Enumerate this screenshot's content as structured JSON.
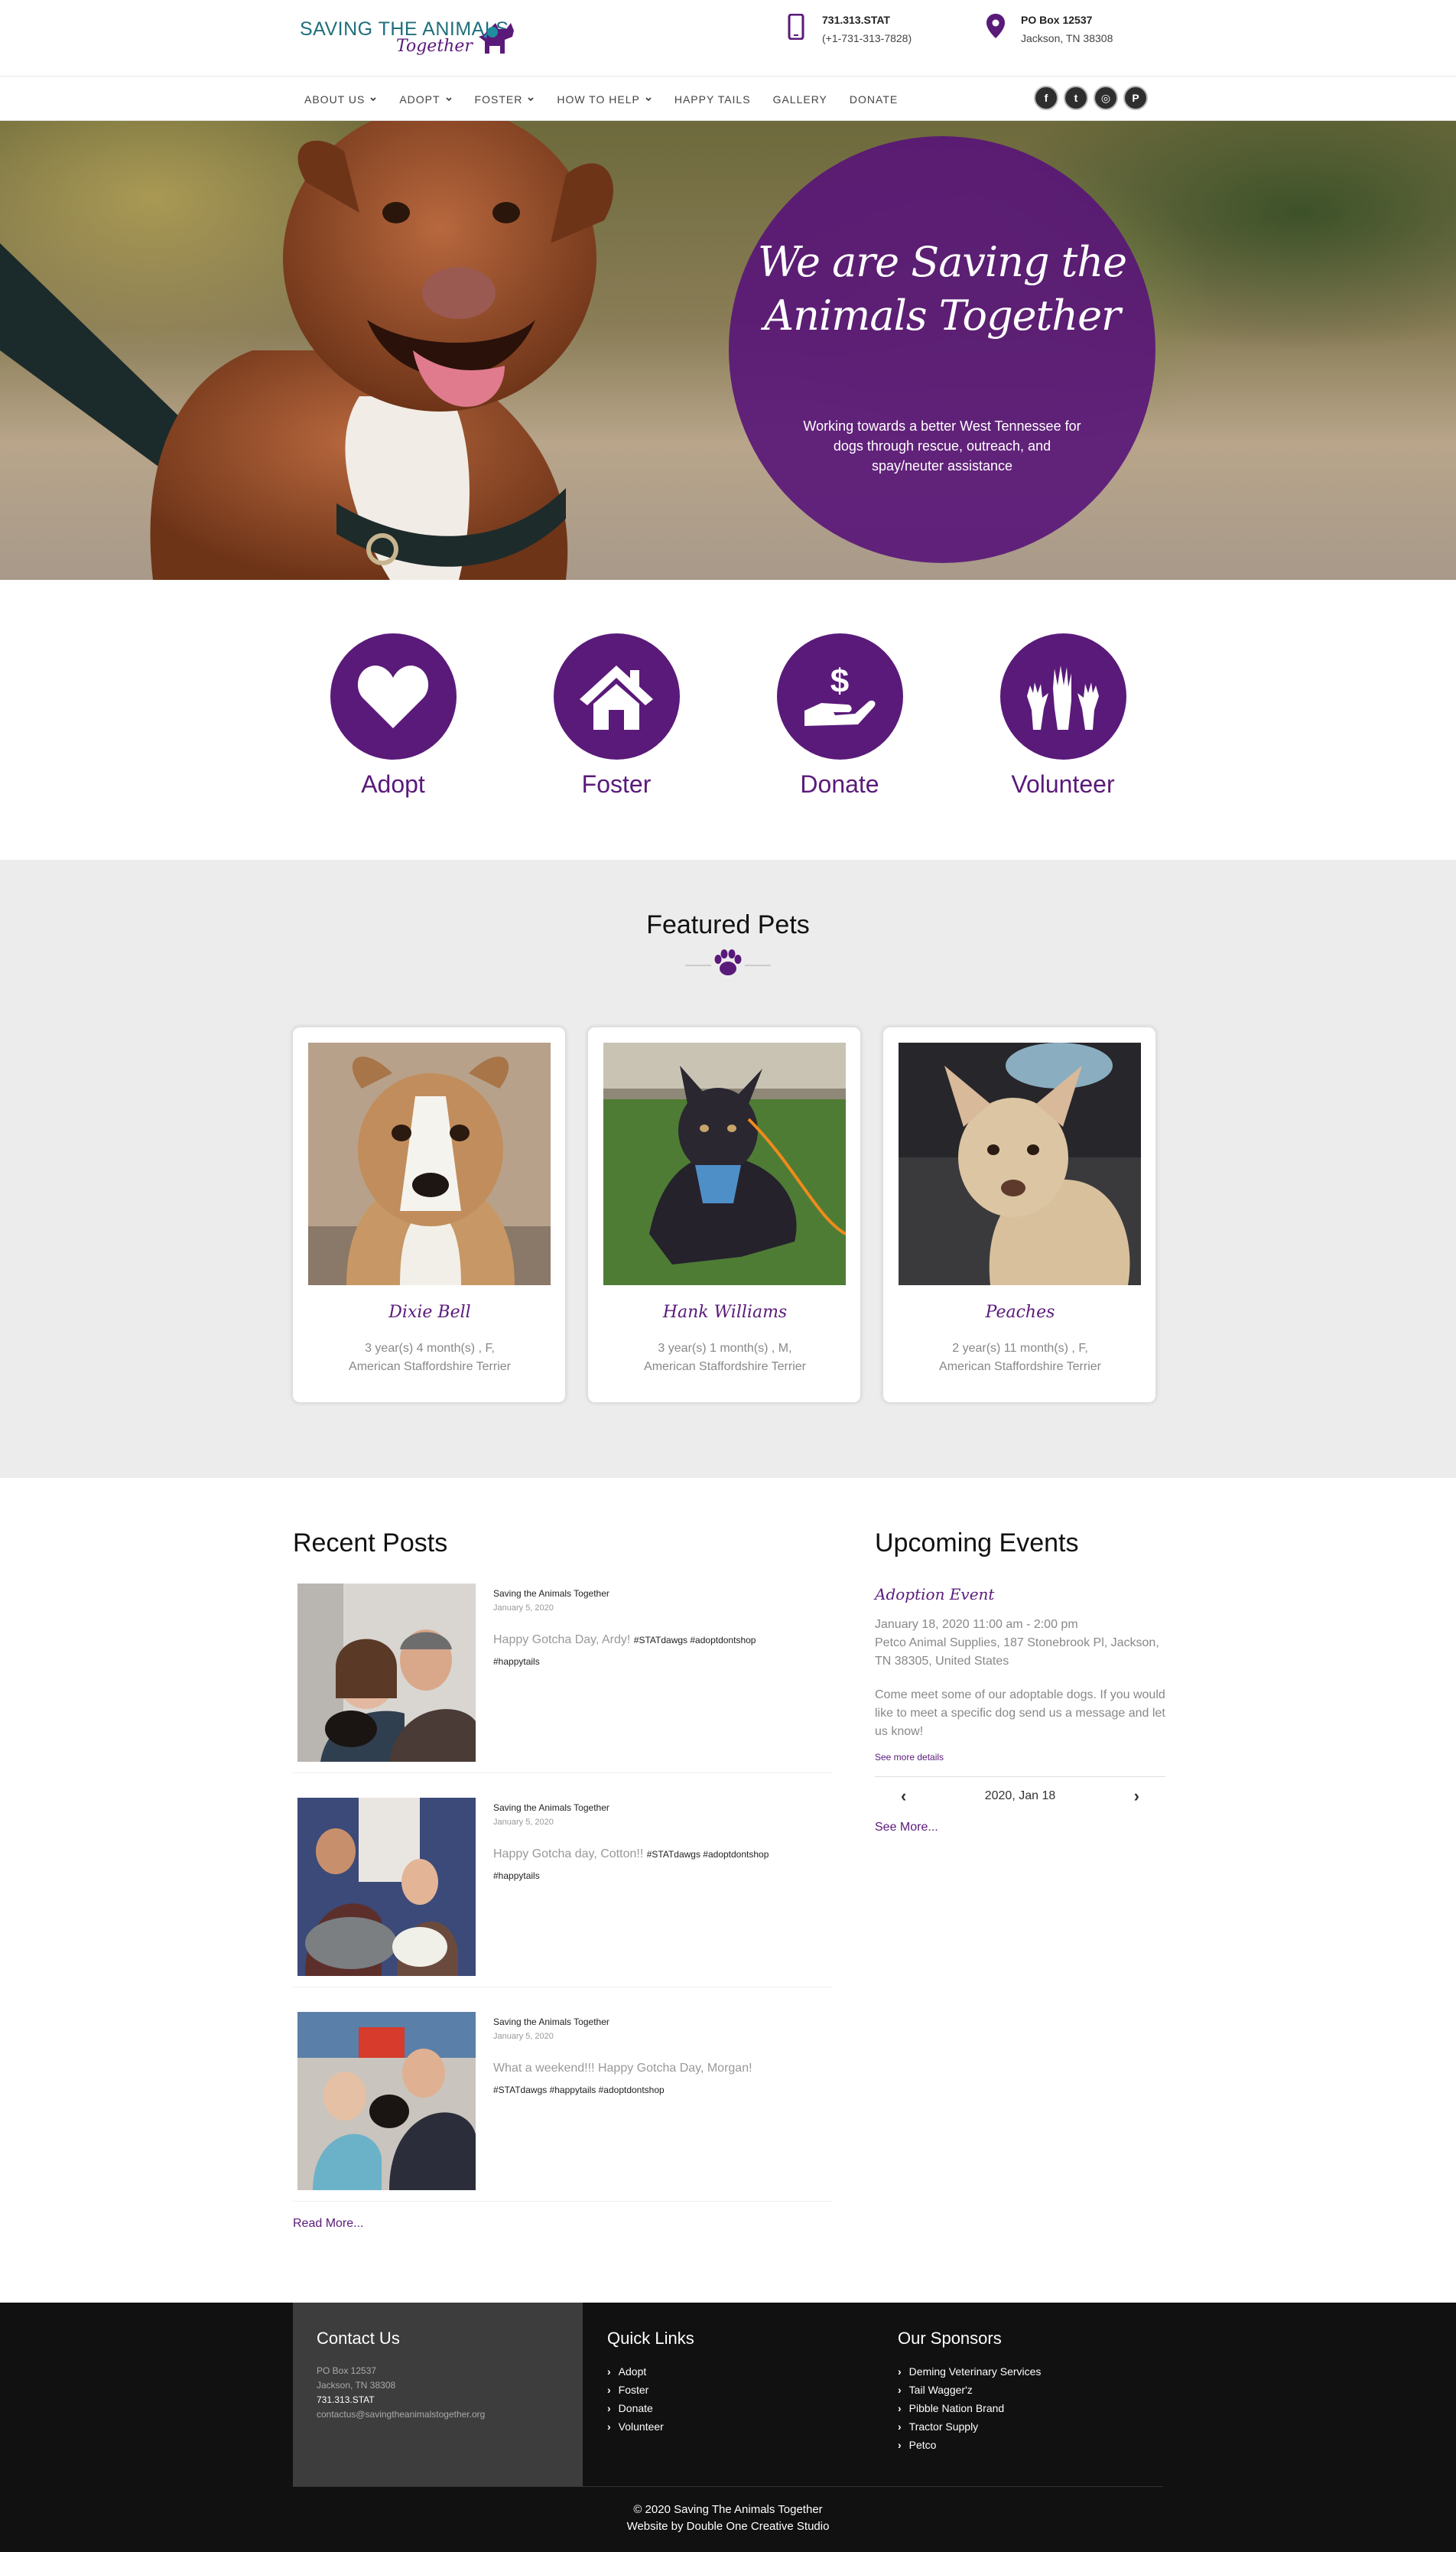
{
  "header": {
    "logo_line1": "SAVING THE ANIMALS",
    "logo_line2": "Together",
    "phone_label": "731.313.STAT",
    "phone_number": "(+1-731-313-7828)",
    "address_line1": "PO Box 12537",
    "address_line2": "Jackson, TN 38308"
  },
  "nav": {
    "items": [
      {
        "label": "ABOUT US",
        "dropdown": true
      },
      {
        "label": "ADOPT",
        "dropdown": true
      },
      {
        "label": "FOSTER",
        "dropdown": true
      },
      {
        "label": "HOW TO HELP",
        "dropdown": true
      },
      {
        "label": "HAPPY TAILS",
        "dropdown": false
      },
      {
        "label": "GALLERY",
        "dropdown": false
      },
      {
        "label": "DONATE",
        "dropdown": false
      }
    ],
    "social": [
      {
        "icon": "facebook-icon",
        "glyph": "f"
      },
      {
        "icon": "twitter-icon",
        "glyph": "t"
      },
      {
        "icon": "instagram-icon",
        "glyph": "◎"
      },
      {
        "icon": "pinterest-icon",
        "glyph": "P"
      }
    ]
  },
  "hero": {
    "title": "We are Saving the Animals Together",
    "subtitle": "Working towards a better West Tennessee for dogs through rescue, outreach, and spay/neuter assistance"
  },
  "actions": [
    {
      "label": "Adopt",
      "icon": "heart-icon"
    },
    {
      "label": "Foster",
      "icon": "house-icon"
    },
    {
      "label": "Donate",
      "icon": "donate-hand-icon"
    },
    {
      "label": "Volunteer",
      "icon": "raised-hands-icon"
    }
  ],
  "featured": {
    "title": "Featured Pets",
    "pets": [
      {
        "name": "Dixie Bell",
        "age": "3 year(s) 4 month(s) , F,",
        "breed": "American Staffordshire Terrier"
      },
      {
        "name": "Hank Williams",
        "age": "3 year(s) 1 month(s) , M,",
        "breed": "American Staffordshire Terrier"
      },
      {
        "name": "Peaches",
        "age": "2 year(s) 11 month(s) , F,",
        "breed": "American Staffordshire Terrier"
      }
    ]
  },
  "posts": {
    "title": "Recent Posts",
    "items": [
      {
        "author": "Saving the Animals Together",
        "date": "January 5, 2020",
        "text": "Happy Gotcha Day, Ardy!",
        "tags_inline": "#STATdawgs #adoptdontshop",
        "tags_next": "#happytails"
      },
      {
        "author": "Saving the Animals Together",
        "date": "January 5, 2020",
        "text": "Happy Gotcha day, Cotton!!",
        "tags_inline": "#STATdawgs #adoptdontshop",
        "tags_next": "#happytails"
      },
      {
        "author": "Saving the Animals Together",
        "date": "January 5, 2020",
        "text": "What a weekend!!! Happy Gotcha Day, Morgan!",
        "tags_inline": "",
        "tags_next": "#STATdawgs #happytails #adoptdontshop"
      }
    ],
    "read_more": "Read More..."
  },
  "events": {
    "title": "Upcoming Events",
    "event_title": "Adoption Event",
    "when": "January 18, 2020  11:00 am - 2:00 pm",
    "where": "Petco Animal Supplies, 187 Stonebrook Pl, Jackson, TN 38305, United States",
    "description": "Come meet some of our adoptable dogs. If you would like to meet a specific dog send us a message and let us know!",
    "see_details": "See more details",
    "cal_label": "2020, Jan 18",
    "see_more": "See More..."
  },
  "footer": {
    "contact_title": "Contact Us",
    "contact_lines": [
      "PO Box 12537",
      "Jackson, TN 38308"
    ],
    "contact_phone": "731.313.STAT",
    "contact_email": "contactus@savingtheanimalstogether.org",
    "quick_title": "Quick Links",
    "quick_links": [
      "Adopt",
      "Foster",
      "Donate",
      "Volunteer"
    ],
    "sponsors_title": "Our Sponsors",
    "sponsors": [
      "Deming Veterinary Services",
      "Tail Wagger'z",
      "Pibble Nation Brand",
      "Tractor Supply",
      "Petco"
    ],
    "copyright": "© 2020 Saving The Animals Together",
    "credit": "Website by Double One Creative Studio"
  },
  "colors": {
    "brand_purple": "#5a1a7a",
    "brand_teal": "#1f6f7c",
    "footer_bg": "#111111"
  }
}
